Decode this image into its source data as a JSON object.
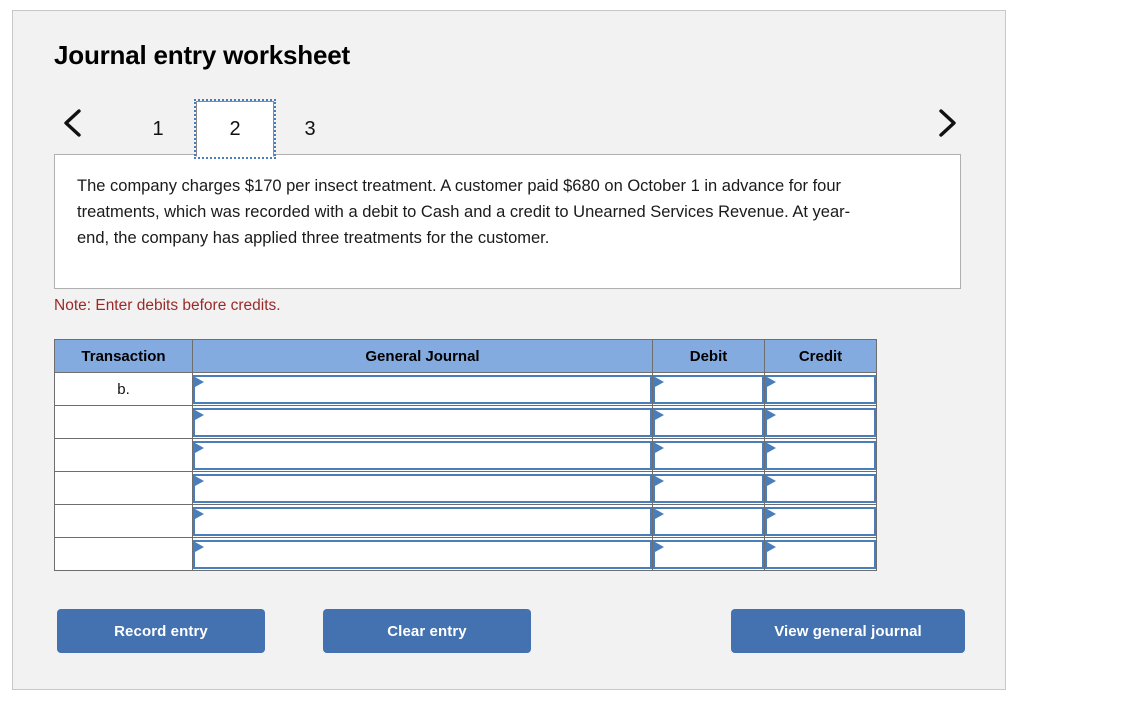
{
  "panel": {
    "title": "Journal entry worksheet"
  },
  "nav": {
    "prev_icon": "chevron-left-icon",
    "next_icon": "chevron-right-icon",
    "tabs": [
      {
        "label": "1",
        "active": false
      },
      {
        "label": "2",
        "active": true
      },
      {
        "label": "3",
        "active": false
      }
    ]
  },
  "scenario": {
    "text": "The company charges $170 per insect treatment. A customer paid $680 on October 1 in advance for four treatments, which was recorded with a debit to Cash and a credit to Unearned Services Revenue. At year-end, the company has applied three treatments for the customer."
  },
  "note": {
    "text": "Note: Enter debits before credits."
  },
  "journal": {
    "headers": {
      "transaction": "Transaction",
      "general_journal": "General Journal",
      "debit": "Debit",
      "credit": "Credit"
    },
    "rows": [
      {
        "transaction": "b.",
        "account": "",
        "debit": "",
        "credit": ""
      },
      {
        "transaction": "",
        "account": "",
        "debit": "",
        "credit": ""
      },
      {
        "transaction": "",
        "account": "",
        "debit": "",
        "credit": ""
      },
      {
        "transaction": "",
        "account": "",
        "debit": "",
        "credit": ""
      },
      {
        "transaction": "",
        "account": "",
        "debit": "",
        "credit": ""
      },
      {
        "transaction": "",
        "account": "",
        "debit": "",
        "credit": ""
      }
    ]
  },
  "actions": {
    "record_entry": "Record entry",
    "clear_entry": "Clear entry",
    "view_general_journal": "View general journal"
  },
  "colors": {
    "panel_bg": "#f2f2f2",
    "panel_border": "#c8c8c8",
    "table_header_blue": "#83abe0",
    "field_border_blue": "#4a7ebb",
    "button_blue": "#4472b0",
    "note_red": "#9a2a2a",
    "table_border_gray": "#6e6e6e"
  }
}
